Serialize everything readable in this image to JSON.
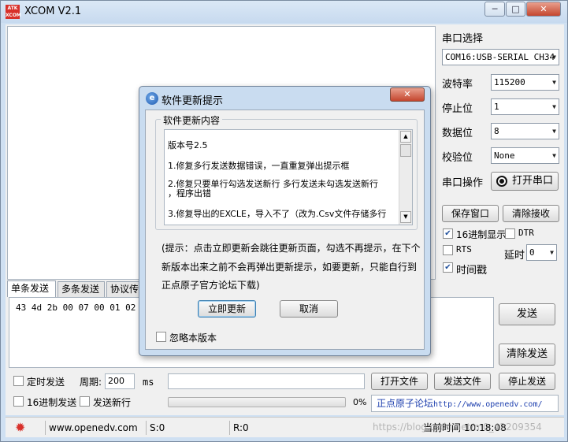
{
  "app": {
    "title": "XCOM V2.1",
    "logo_text_top": "ATK",
    "logo_text_bottom": "XCOM"
  },
  "window_controls": {
    "minimize": "─",
    "maximize": "□",
    "close": "✕"
  },
  "right_panel": {
    "port_select_label": "串口选择",
    "port_value": "COM16:USB-SERIAL CH34",
    "baud_label": "波特率",
    "baud_value": "115200",
    "stopbit_label": "停止位",
    "stopbit_value": "1",
    "databit_label": "数据位",
    "databit_value": "8",
    "parity_label": "校验位",
    "parity_value": "None",
    "port_op_label": "串口操作",
    "open_port_button": "打开串口",
    "save_window_button": "保存窗口",
    "clear_recv_button": "清除接收",
    "hex_display_label": "16进制显示",
    "dtr_label": "DTR",
    "rts_label": "RTS",
    "delay_label": "延时",
    "delay_value": "0",
    "timestamp_label": "时间戳"
  },
  "tabs": [
    "单条发送",
    "多条发送",
    "协议传输"
  ],
  "send_area": {
    "content": "43 4d 2b 00 07 00 01 02 0c"
  },
  "send_buttons": {
    "send": "发送",
    "clear_send": "清除发送"
  },
  "bottom": {
    "timed_send_label": "定时发送",
    "period_label": "周期:",
    "period_value": "200",
    "ms_label": "ms",
    "hex_send_label": "16进制发送",
    "send_newline_label": "发送新行",
    "progress_text": "0%",
    "progress_value": 0,
    "open_file_button": "打开文件",
    "send_file_button": "发送文件",
    "stop_send_button": "停止发送",
    "forum_label": "正点原子论坛",
    "forum_url": "http://www.openedv.com/"
  },
  "statusbar": {
    "site": "www.openedv.com",
    "sent": "S:0",
    "received": "R:0",
    "time": "当前时间 10:18:08"
  },
  "watermark": "https://blog.csdn.net/m0_42209354",
  "dialog": {
    "title": "软件更新提示",
    "close_symbol": "✕",
    "group_title": "软件更新内容",
    "notes": {
      "version": "版本号2.5",
      "item1": "1.修复多行发送数据错误，一直重复弹出提示框",
      "item2_line1": "2.修复只要单行勾选发送新行 多行发送未勾选发送新行",
      "item2_line2": "，程序出错",
      "item3": "3.修复导出的EXCLE，导入不了（改为.Csv文件存储多行"
    },
    "hint_line1": "(提示：点击立即更新会跳往更新页面，勾选不再提示，在下个",
    "hint_line2": "新版本出来之前不会再弹出更新提示，如要更新，只能自行到",
    "hint_line3": "正点原子官方论坛下载)",
    "update_now_button": "立即更新",
    "cancel_button": "取消",
    "ignore_version_label": "忽略本版本"
  },
  "colors": {
    "accent": "#1f5ab0",
    "link": "#1d3fae",
    "close": "#c4462e"
  }
}
